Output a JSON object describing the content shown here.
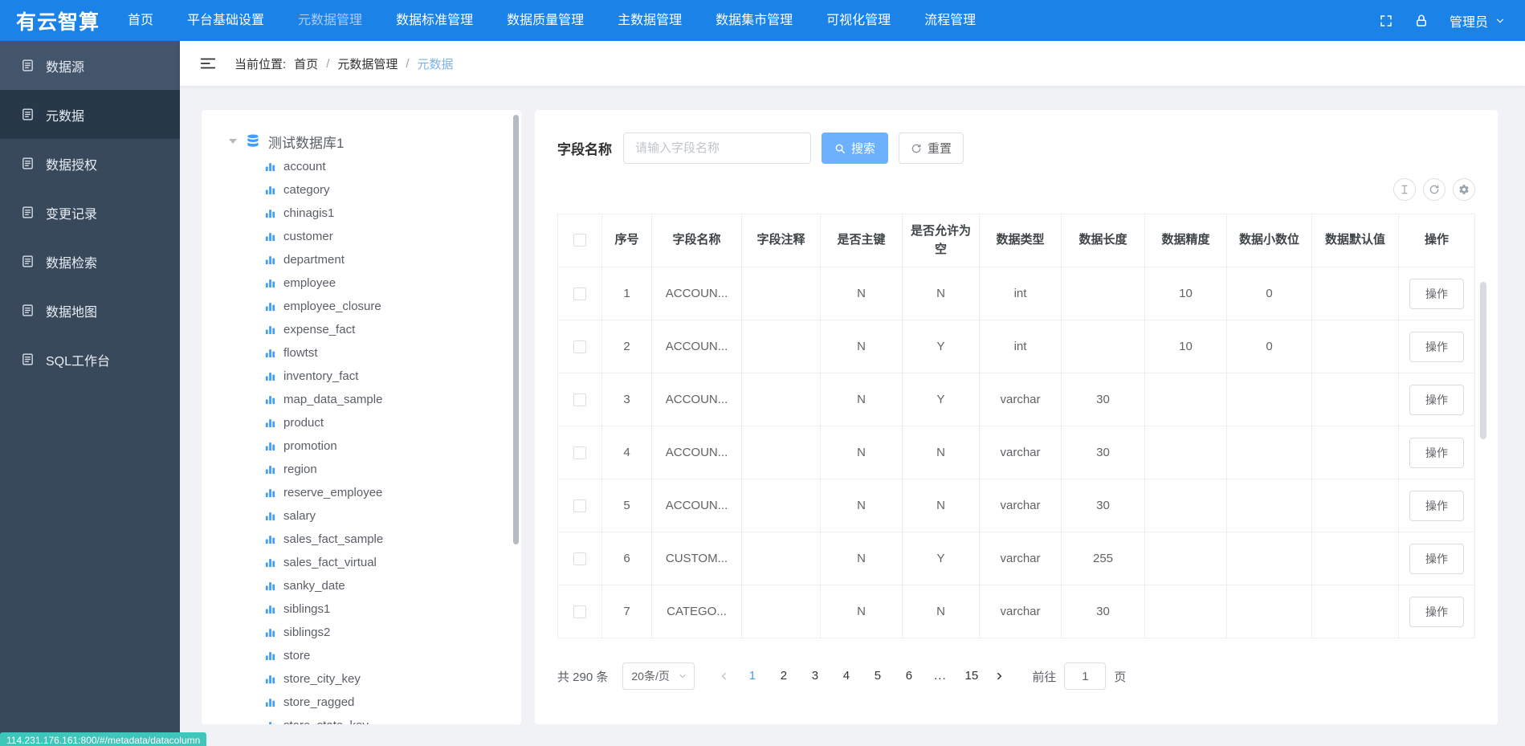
{
  "navbar": {
    "logo": "有云智算",
    "items": [
      {
        "label": "首页",
        "class": ""
      },
      {
        "label": "平台基础设置",
        "class": ""
      },
      {
        "label": "元数据管理",
        "class": "active"
      },
      {
        "label": "数据标准管理",
        "class": ""
      },
      {
        "label": "数据质量管理",
        "class": ""
      },
      {
        "label": "主数据管理",
        "class": ""
      },
      {
        "label": "数据集市管理",
        "class": ""
      },
      {
        "label": "可视化管理",
        "class": ""
      },
      {
        "label": "流程管理",
        "class": ""
      }
    ],
    "user": "管理员"
  },
  "sidebar": {
    "items": [
      {
        "label": "数据源",
        "class": "hover"
      },
      {
        "label": "元数据",
        "class": "active"
      },
      {
        "label": "数据授权",
        "class": ""
      },
      {
        "label": "变更记录",
        "class": ""
      },
      {
        "label": "数据检索",
        "class": ""
      },
      {
        "label": "数据地图",
        "class": ""
      },
      {
        "label": "SQL工作台",
        "class": ""
      }
    ]
  },
  "breadcrumb": {
    "prefix": "当前位置:",
    "separator": "/",
    "items": [
      {
        "label": "首页",
        "class": ""
      },
      {
        "label": "元数据管理",
        "class": ""
      },
      {
        "label": "元数据",
        "class": "current"
      }
    ]
  },
  "tree": {
    "root": "测试数据库1",
    "tables": [
      "account",
      "category",
      "chinagis1",
      "customer",
      "department",
      "employee",
      "employee_closure",
      "expense_fact",
      "flowtst",
      "inventory_fact",
      "map_data_sample",
      "product",
      "promotion",
      "region",
      "reserve_employee",
      "salary",
      "sales_fact_sample",
      "sales_fact_virtual",
      "sanky_date",
      "siblings1",
      "siblings2",
      "store",
      "store_city_key",
      "store_ragged",
      "store_state_key"
    ]
  },
  "search": {
    "label": "字段名称",
    "placeholder": "请输入字段名称",
    "search_button": "搜索",
    "reset_button": "重置"
  },
  "table": {
    "headers": [
      "序号",
      "字段名称",
      "字段注释",
      "是否主键",
      "是否允许为空",
      "数据类型",
      "数据长度",
      "数据精度",
      "数据小数位",
      "数据默认值",
      "操作"
    ],
    "action_label": "操作",
    "rows": [
      {
        "no": "1",
        "name": "ACCOUN...",
        "comment": "",
        "pk": "N",
        "nullable": "N",
        "type": "int",
        "length": "",
        "precision": "10",
        "scale": "0",
        "default": ""
      },
      {
        "no": "2",
        "name": "ACCOUN...",
        "comment": "",
        "pk": "N",
        "nullable": "Y",
        "type": "int",
        "length": "",
        "precision": "10",
        "scale": "0",
        "default": ""
      },
      {
        "no": "3",
        "name": "ACCOUN...",
        "comment": "",
        "pk": "N",
        "nullable": "Y",
        "type": "varchar",
        "length": "30",
        "precision": "",
        "scale": "",
        "default": ""
      },
      {
        "no": "4",
        "name": "ACCOUN...",
        "comment": "",
        "pk": "N",
        "nullable": "N",
        "type": "varchar",
        "length": "30",
        "precision": "",
        "scale": "",
        "default": ""
      },
      {
        "no": "5",
        "name": "ACCOUN...",
        "comment": "",
        "pk": "N",
        "nullable": "N",
        "type": "varchar",
        "length": "30",
        "precision": "",
        "scale": "",
        "default": ""
      },
      {
        "no": "6",
        "name": "CUSTOM...",
        "comment": "",
        "pk": "N",
        "nullable": "Y",
        "type": "varchar",
        "length": "255",
        "precision": "",
        "scale": "",
        "default": ""
      },
      {
        "no": "7",
        "name": "CATEGO...",
        "comment": "",
        "pk": "N",
        "nullable": "N",
        "type": "varchar",
        "length": "30",
        "precision": "",
        "scale": "",
        "default": ""
      }
    ]
  },
  "pagination": {
    "total": "共 290 条",
    "page_size": "20条/页",
    "pages": [
      {
        "label": "1",
        "class": "active"
      },
      {
        "label": "2",
        "class": ""
      },
      {
        "label": "3",
        "class": ""
      },
      {
        "label": "4",
        "class": ""
      },
      {
        "label": "5",
        "class": ""
      },
      {
        "label": "6",
        "class": ""
      },
      {
        "label": "...",
        "class": "more"
      },
      {
        "label": "15",
        "class": ""
      }
    ],
    "goto_label": "前往",
    "goto_value": "1",
    "goto_suffix": "页"
  },
  "status_url": "114.231.176.161:800/#/metadata/datacolumn",
  "colors": {
    "navbar_bg": "#1b82e8",
    "primary": "#409eff",
    "search_button_bg": "#6bb1fb",
    "sidebar_bg": "#38495c",
    "sidebar_active_bg": "#273848",
    "status_tooltip_bg": "#3fc6ba"
  },
  "icons": [
    "fullscreen-icon",
    "lock-icon",
    "chevron-down-icon",
    "document-icon",
    "collapse-menu-icon",
    "caret-down-icon",
    "database-icon",
    "bar-chart-icon",
    "search-icon",
    "refresh-icon",
    "text-cursor-icon",
    "gear-icon",
    "chevron-left-icon",
    "chevron-right-icon"
  ]
}
